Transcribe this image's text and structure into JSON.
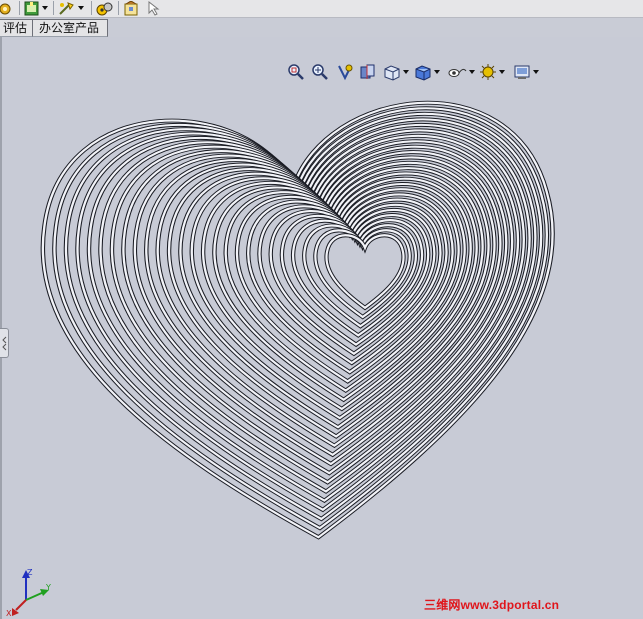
{
  "toolbar": {
    "items": [
      "evaluate-icon",
      "rebuild-icon",
      "options-icon",
      "addins-icon",
      "help-icon",
      "select-icon"
    ]
  },
  "tabs": {
    "tab_evaluate": "评估",
    "tab_office": "办公室产品"
  },
  "view_toolbar": {
    "items": [
      "zoom-to-fit-icon",
      "zoom-to-area-icon",
      "previous-view-icon",
      "section-view-icon",
      "view-orientation-icon",
      "display-style-icon",
      "hide-show-items-icon",
      "edit-appearance-icon",
      "apply-scene-icon"
    ]
  },
  "triad": {
    "x_label": "X",
    "y_label": "Y",
    "z_label": "Z"
  },
  "watermark": "三维网www.3dportal.cn",
  "colors": {
    "background": "#c8cbd6",
    "model_tube": "#f2f3f8",
    "model_edge": "#1a1c24",
    "watermark": "#e0151b"
  }
}
